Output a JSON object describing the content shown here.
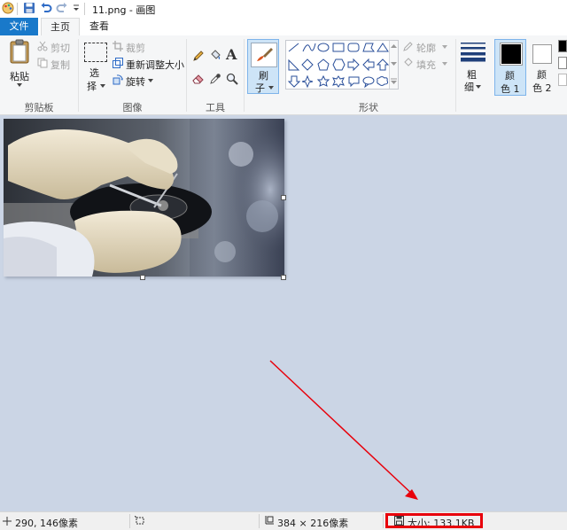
{
  "window": {
    "title": "11.png - 画图"
  },
  "tabs": {
    "file": "文件",
    "home": "主页",
    "view": "查看"
  },
  "clipboard": {
    "paste": "粘贴",
    "cut": "剪切",
    "copy": "复制",
    "group": "剪贴板"
  },
  "image": {
    "select_top": "选",
    "select_bottom": "择",
    "crop": "裁剪",
    "resize": "重新调整大小",
    "rotate": "旋转",
    "group": "图像"
  },
  "tools": {
    "group": "工具",
    "text_icon_glyph": "A"
  },
  "brushes": {
    "top": "刷",
    "bottom": "子"
  },
  "shapes": {
    "outline": "轮廓",
    "fill": "填充",
    "group": "形状"
  },
  "size": {
    "top": "粗",
    "bottom": "细"
  },
  "colors": {
    "color1_top": "颜",
    "color1_bottom": "色 1",
    "color2_top": "颜",
    "color2_bottom": "色 2",
    "color1_hex": "#000000",
    "color2_hex": "#ffffff"
  },
  "status": {
    "cursor": "290, 146像素",
    "dimensions": "384 × 216像素",
    "size": "大小: 133.1KB"
  },
  "accent": {
    "file_tab": "#1979ca",
    "highlight": "#e8000b"
  }
}
